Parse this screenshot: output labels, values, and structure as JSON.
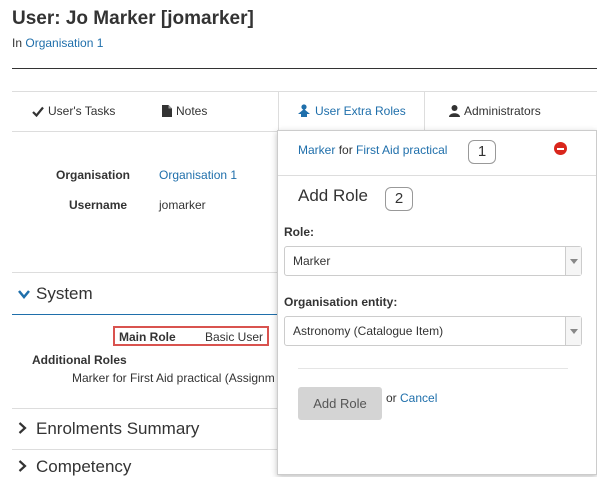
{
  "header": {
    "title": "User: Jo Marker [jomarker]",
    "in_prefix": "In",
    "org_link": "Organisation 1"
  },
  "tabs": [
    {
      "label": "User's Tasks",
      "icon": "check-icon"
    },
    {
      "label": "Notes",
      "icon": "document-icon"
    },
    {
      "label": "User Extra Roles",
      "icon": "user-up-icon",
      "active": true
    },
    {
      "label": "Administrators",
      "icon": "person-icon"
    }
  ],
  "details": {
    "organisation_label": "Organisation",
    "organisation_value": "Organisation 1",
    "username_label": "Username",
    "username_value": "jomarker"
  },
  "system": {
    "heading": "System",
    "main_role_label": "Main Role",
    "main_role_value": "Basic User",
    "additional_roles_label": "Additional Roles",
    "additional_roles_value": "Marker for First Aid practical (Assignm"
  },
  "sections": {
    "enrolments": "Enrolments Summary",
    "competency": "Competency"
  },
  "popover": {
    "existing_role": {
      "role": "Marker",
      "joiner": "for",
      "target": "First Aid practical",
      "badge": "1"
    },
    "add_role_heading": "Add Role",
    "add_role_badge": "2",
    "role_label": "Role:",
    "role_value": "Marker",
    "entity_label": "Organisation entity:",
    "entity_value": "Astronomy (Catalogue Item)",
    "add_button": "Add Role",
    "or_text": "or",
    "cancel_link": "Cancel"
  },
  "colors": {
    "link": "#1f6fab",
    "highlight_border": "#d9534f",
    "remove_icon": "#d9261c"
  }
}
